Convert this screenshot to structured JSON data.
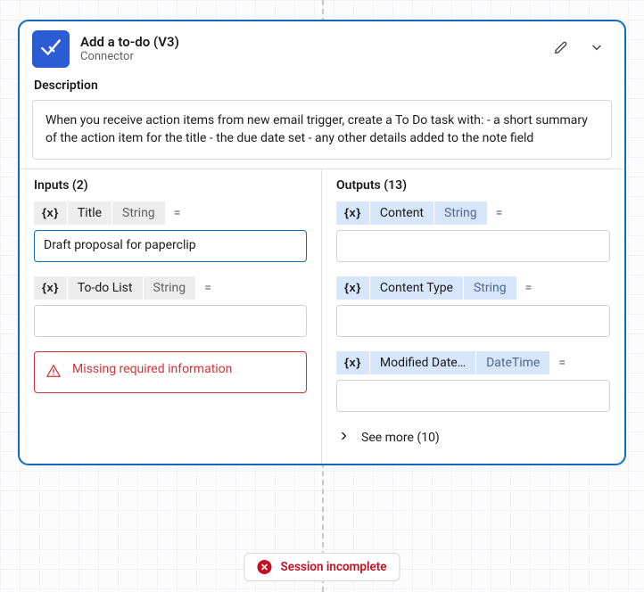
{
  "header": {
    "title": "Add a to-do (V3)",
    "subtitle": "Connector",
    "icon": "checkmark-icon"
  },
  "description": {
    "label": "Description",
    "text": "When you receive action items from new email trigger, create a To Do task with: - a short summary of the action item for the title - the due date set - any other details added to the note field"
  },
  "inputs": {
    "heading": "Inputs (2)",
    "fields": [
      {
        "token": "{x}",
        "name": "Title",
        "type": "String",
        "equals": "=",
        "value": "Draft proposal for paperclip",
        "active": true
      },
      {
        "token": "{x}",
        "name": "To-do List",
        "type": "String",
        "equals": "=",
        "value": "",
        "active": false
      }
    ],
    "error": "Missing required information"
  },
  "outputs": {
    "heading": "Outputs (13)",
    "fields": [
      {
        "token": "{x}",
        "name": "Content",
        "type": "String",
        "equals": "=",
        "value": ""
      },
      {
        "token": "{x}",
        "name": "Content Type",
        "type": "String",
        "equals": "=",
        "value": ""
      },
      {
        "token": "{x}",
        "name": "Modified Date…",
        "type": "DateTime",
        "equals": "=",
        "value": ""
      }
    ],
    "see_more": "See more (10)"
  },
  "status": {
    "text": "Session incomplete"
  }
}
